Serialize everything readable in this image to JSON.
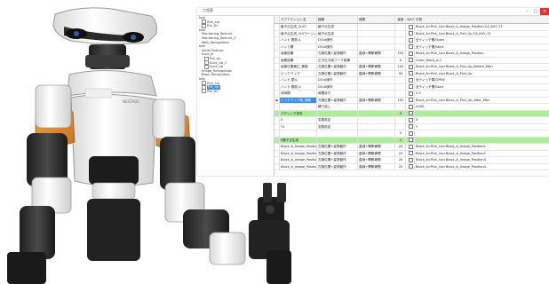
{
  "window": {
    "title": "工程表"
  },
  "tree": {
    "items": [
      {
        "label": "test",
        "checkbox": false,
        "indent": 0
      },
      {
        "label": "Pick_Up",
        "checkbox": true,
        "indent": 1
      },
      {
        "label": "Put_Dn",
        "checkbox": true,
        "indent": 1
      },
      {
        "label": "test",
        "checkbox": false,
        "indent": 0
      },
      {
        "label": "Monitoring_Posture",
        "checkbox": false,
        "indent": 1
      },
      {
        "label": "Monitoring_Posture_2",
        "checkbox": false,
        "indent": 1
      },
      {
        "label": "Wait_Recognition",
        "checkbox": false,
        "indent": 1
      },
      {
        "label": "test",
        "checkbox": false,
        "indent": 0
      },
      {
        "label": "Initial Posture",
        "checkbox": false,
        "indent": 1
      },
      {
        "label": "Suck_B",
        "checkbox": false,
        "indent": 1
      },
      {
        "label": "Put_on",
        "checkbox": true,
        "indent": 2
      },
      {
        "label": "Suck_Up_2",
        "checkbox": true,
        "indent": 2
      },
      {
        "label": "Suck_Up",
        "checkbox": true,
        "indent": 2
      },
      {
        "label": "Image_Recognition",
        "checkbox": false,
        "indent": 1
      },
      {
        "label": "Base_Recognition",
        "checkbox": false,
        "indent": 1
      },
      {
        "label": "test",
        "checkbox": false,
        "indent": 0
      },
      {
        "label": "Pick_Up",
        "checkbox": true,
        "indent": 1
      },
      {
        "label": "Put_Up",
        "checkbox": true,
        "indent": 1,
        "selected": true
      },
      {
        "label": "Put_Dn",
        "checkbox": true,
        "indent": 1
      }
    ]
  },
  "grid": {
    "columns": [
      "サブアクション名",
      "種類",
      "補間",
      "速度",
      "WAIT",
      "引数"
    ],
    "rows": [
      {
        "c0": "格子点生成_CLV0",
        "c1": "格子点生成",
        "c2": "",
        "c3": "",
        "c5": "Block_A>Pick_Up>Block_A_Image_Position,CA_KXY_Y1"
      },
      {
        "c0": "格子点生成_CLVマージン",
        "c1": "格子点生成",
        "c2": "",
        "c3": "",
        "c5": "Block_A>Pick_Up>Block_A_Pick_Up,CA_KXY_Y1"
      },
      {
        "c0": "ハンド 開放ル",
        "c1": "DOut操作",
        "c2": "",
        "c3": "",
        "c5": "全ティッチ開/Open"
      },
      {
        "c0": "ハンド開",
        "c1": "DOut操作",
        "c2": "",
        "c3": "",
        "c5": "全ティッチ開/Start"
      },
      {
        "c0": "画像認識",
        "c1": "左腕位置+姿勢動作",
        "c2": "直線+関節補間",
        "c3": "100",
        "c5": "Block_A>Pick_Up>Block_A_Image_Position"
      },
      {
        "c0": "画像認識",
        "c1": "正方位平面ワーク認識",
        "c2": "",
        "c3": "0",
        "c5": "Camr_Block_A,2"
      },
      {
        "c0": "画像位置補正_移動",
        "c1": "左腕位置+姿勢動作",
        "c2": "直線+関節補間",
        "c3": "100",
        "c5": "Block_A>Pick_Up>Block_A_Pick_Up_Before_Mari"
      },
      {
        "c0": "ピックアップ",
        "c1": "左腕位置+姿勢動作",
        "c2": "直線+関節補間",
        "c3": "50",
        "c5": "Block_A>Pick_Up>Block_A_Pick_Up"
      },
      {
        "c0": "ハンド 閉ル",
        "c1": "DOut操作",
        "c2": "",
        "c3": "",
        "c5": "全ティッチ閉/OPEN"
      },
      {
        "c0": "ハンド 開放ル",
        "c1": "DOut操作",
        "c2": "",
        "c3": "",
        "c5": "全ティッチ開/Start"
      },
      {
        "c0": "待時間",
        "c1": "時間待ち",
        "c2": "",
        "c3": "",
        "c5": "0.5"
      },
      {
        "c0": "ピックアップ後_移動",
        "c1": "左腕位置+姿勢動作",
        "c2": "直線+関節補間",
        "c3": "100",
        "c5": "Block_A>Pick_Up>Block_A_Pick_Up_After_Mari",
        "selected": true,
        "indicator": "▶"
      },
      {
        "c0": "",
        "c1": "繰り返し",
        "c2": "",
        "c3": "",
        "c5": "ALDA"
      },
      {
        "c0": "パディング条件",
        "c1": "",
        "c2": "",
        "c3": "0",
        "c5": "",
        "section": true
      },
      {
        "c0": "X",
        "c1": "変数設定",
        "c2": "",
        "c3": "",
        "c5": "X"
      },
      {
        "c0": "Y1",
        "c1": "変数設定",
        "c2": "",
        "c3": "",
        "c5": "Y"
      },
      {
        "c0": "",
        "c1": "",
        "c2": "",
        "c3": "0",
        "c5": ""
      },
      {
        "c0": "P格子点生成",
        "c1": "",
        "c2": "",
        "c3": "0",
        "c5": "",
        "section": true
      },
      {
        "c0": "Block_A_Image_Position1",
        "c1": "左腕位置+姿勢動作",
        "c2": "直線+関節補間",
        "c3": "20",
        "c5": "Block_A>Pick_Up>Block_A_Image_Position1"
      },
      {
        "c0": "Block_A_Image_Position2",
        "c1": "左腕位置+姿勢動作",
        "c2": "直線+関節補間",
        "c3": "20",
        "c5": "Block_A>Pick_Up>Block_A_Image_Position2"
      },
      {
        "c0": "Block_A_Image_Position3",
        "c1": "左腕位置+姿勢動作",
        "c2": "直線+関節補間",
        "c3": "20",
        "c5": "Block_A>Pick_Up>Block_A_Image_Position3"
      },
      {
        "c0": "Block_A_Image_Position4",
        "c1": "左腕位置+姿勢動作",
        "c2": "直線+関節補間",
        "c3": "20",
        "c5": "Block_A>Pick_Up>Block_A_Image_Position4"
      }
    ]
  },
  "robot": {
    "label": "NEXTAGE"
  }
}
